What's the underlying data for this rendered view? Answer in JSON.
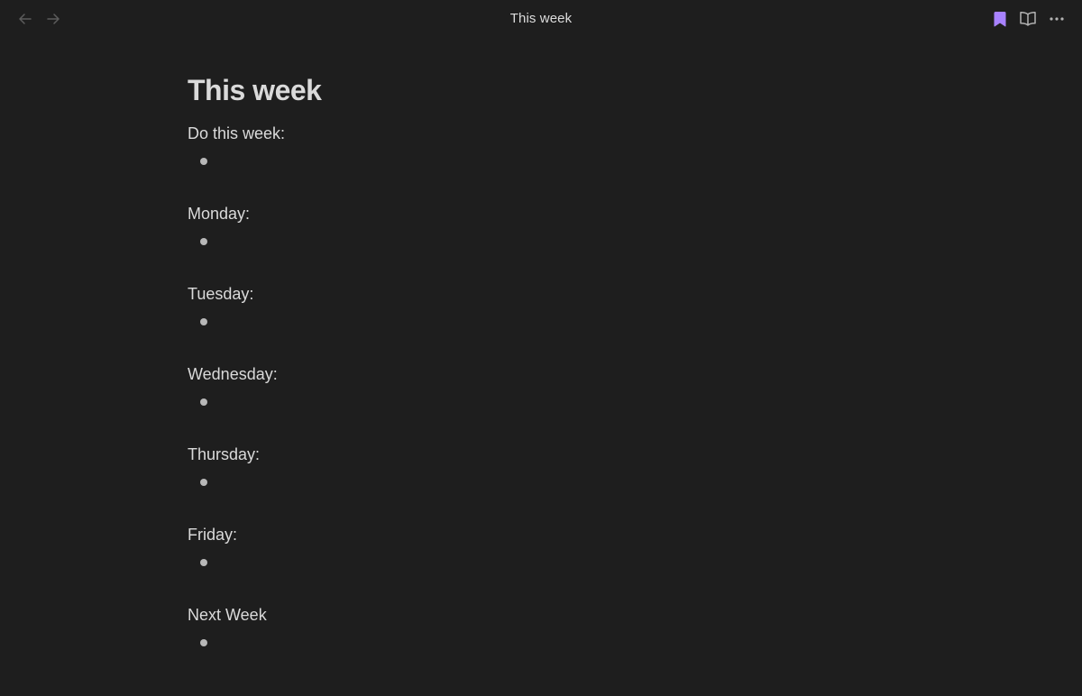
{
  "header": {
    "view_title": "This week",
    "icons": {
      "back": "arrow-left-icon",
      "forward": "arrow-right-icon",
      "bookmark": "bookmark-icon",
      "reading_view": "book-open-icon",
      "more": "more-horizontal-icon"
    }
  },
  "colors": {
    "background": "#1e1e1e",
    "text": "#dadada",
    "accent": "#a882ff",
    "muted_icon": "#5c5c5c",
    "icon": "#b3b3b3"
  },
  "note": {
    "title": "This week",
    "sections": [
      {
        "label": "Do this week:"
      },
      {
        "label": "Monday:"
      },
      {
        "label": "Tuesday:"
      },
      {
        "label": "Wednesday:"
      },
      {
        "label": "Thursday:"
      },
      {
        "label": "Friday:"
      },
      {
        "label": "Next Week"
      }
    ]
  }
}
